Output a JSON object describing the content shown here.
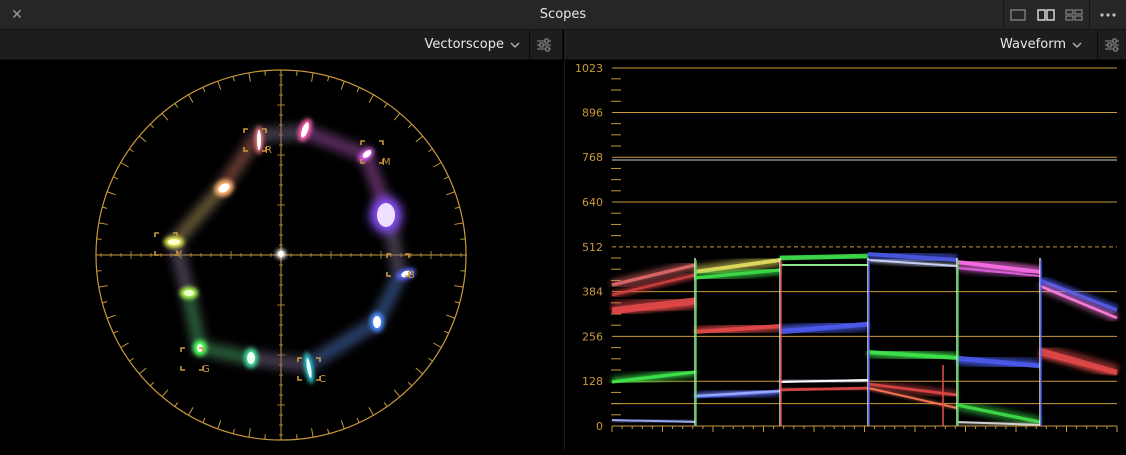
{
  "window": {
    "title": "Scopes"
  },
  "left_panel": {
    "scope_type": "Vectorscope",
    "targets": [
      {
        "label": "R"
      },
      {
        "label": "M"
      },
      {
        "label": "B"
      },
      {
        "label": "C"
      },
      {
        "label": "G"
      },
      {
        "label": "Y"
      }
    ]
  },
  "right_panel": {
    "scope_type": "Waveform",
    "scale_labels": [
      "1023",
      "896",
      "768",
      "640",
      "512",
      "384",
      "256",
      "128",
      "0"
    ]
  },
  "colors": {
    "graticule": "#c9993a",
    "red_trace": "#e04848",
    "green_trace": "#3ee04a",
    "blue_trace": "#4a5ae8"
  },
  "icons": {
    "close": "close-icon",
    "layout_single": "layout-single-icon",
    "layout_dual": "layout-dual-icon",
    "layout_quad": "layout-quad-icon",
    "more": "more-icon",
    "dropdown": "chevron-down-icon",
    "settings": "sliders-icon"
  }
}
